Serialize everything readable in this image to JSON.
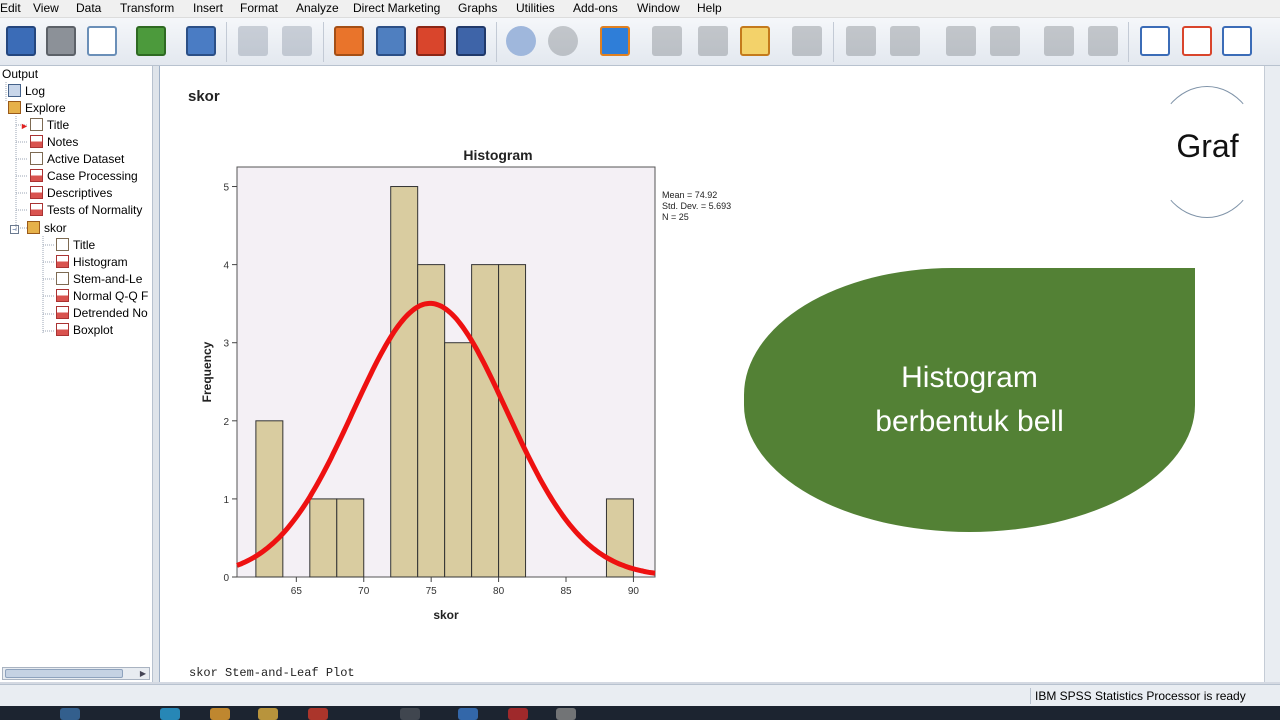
{
  "menu": [
    "Edit",
    "View",
    "Data",
    "Transform",
    "Insert",
    "Format",
    "Analyze",
    "Direct Marketing",
    "Graphs",
    "Utilities",
    "Add-ons",
    "Window",
    "Help"
  ],
  "toolbar_icons": [
    "save-icon",
    "print-icon",
    "print-preview-icon",
    "export-icon",
    "recall-dialog-icon",
    "undo-icon",
    "redo-icon",
    "goto-case-icon",
    "goto-variable-icon",
    "insert-cases-icon",
    "insert-variable-icon",
    "split-file-icon",
    "select-cases-icon",
    "weight-cases-icon",
    "value-labels-icon",
    "show-all-icon",
    "use-sets-icon",
    "designate-window-icon",
    "back-icon",
    "forward-icon",
    "expand-icon",
    "collapse-icon",
    "show-icon",
    "hide-icon",
    "insert-heading-icon",
    "insert-title-icon",
    "insert-text-icon"
  ],
  "outline": {
    "root": "Output",
    "log": "Log",
    "explore": "Explore",
    "explore_children": [
      "Title",
      "Notes",
      "Active Dataset",
      "Case Processing",
      "Descriptives",
      "Tests of Normality"
    ],
    "skor": "skor",
    "skor_children": [
      "Title",
      "Histogram",
      "Stem-and-Le",
      "Normal Q-Q F",
      "Detrended No",
      "Boxplot"
    ]
  },
  "content": {
    "heading": "skor",
    "stem_leaf": "skor Stem-and-Leaf Plot"
  },
  "stats": {
    "mean": "Mean = 74.92",
    "sd": "Std. Dev. = 5.693",
    "n": "N = 25"
  },
  "annotation": {
    "graf": "Graf",
    "callout_line1": "Histogram",
    "callout_line2": "berbentuk bell",
    "callout_color": "#538135"
  },
  "status": {
    "text": "IBM SPSS Statistics Processor is ready"
  },
  "chart_data": {
    "type": "bar",
    "title": "Histogram",
    "xlabel": "skor",
    "ylabel": "Frequency",
    "bins": [
      {
        "from": 62,
        "to": 64,
        "count": 2
      },
      {
        "from": 64,
        "to": 66,
        "count": 0
      },
      {
        "from": 66,
        "to": 68,
        "count": 1
      },
      {
        "from": 68,
        "to": 70,
        "count": 1
      },
      {
        "from": 70,
        "to": 72,
        "count": 0
      },
      {
        "from": 72,
        "to": 74,
        "count": 5
      },
      {
        "from": 74,
        "to": 76,
        "count": 4
      },
      {
        "from": 76,
        "to": 78,
        "count": 3
      },
      {
        "from": 78,
        "to": 80,
        "count": 4
      },
      {
        "from": 80,
        "to": 82,
        "count": 4
      },
      {
        "from": 82,
        "to": 84,
        "count": 0
      },
      {
        "from": 84,
        "to": 86,
        "count": 0
      },
      {
        "from": 86,
        "to": 88,
        "count": 0
      },
      {
        "from": 88,
        "to": 90,
        "count": 1
      }
    ],
    "xticks": [
      65,
      70,
      75,
      80,
      85,
      90
    ],
    "yticks": [
      0,
      1,
      2,
      3,
      4,
      5
    ],
    "xlim": [
      60.6,
      91.6
    ],
    "ylim": [
      0,
      5.25
    ],
    "normal_curve": {
      "mean": 74.92,
      "sd": 5.693,
      "n": 25,
      "bin_width": 2,
      "color": "#ee1111"
    },
    "bar_color": "#d9cca0",
    "grid": false
  }
}
